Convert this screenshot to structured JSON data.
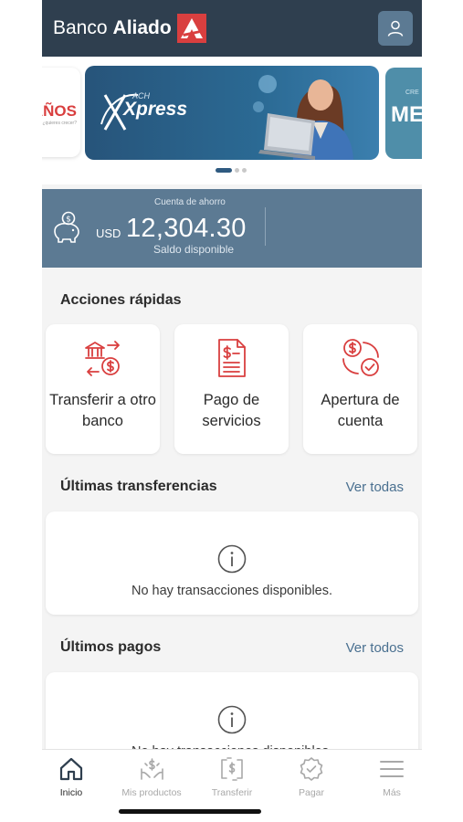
{
  "header": {
    "brand_regular": "Banco",
    "brand_bold": "Aliado"
  },
  "carousel": {
    "left_card_text": "AÑOS",
    "left_card_sub": "¿quieres crecer?",
    "main_card_tag": "ACH",
    "main_card_title": "Xpress",
    "right_card_text": "ME",
    "right_card_sub": "CRE",
    "active_slide": 1,
    "slide_count": 3
  },
  "balance": {
    "account_type": "Cuenta de ahorro",
    "currency": "USD",
    "amount": "12,304.30",
    "caption": "Saldo disponible"
  },
  "quick_actions": {
    "title": "Acciones rápidas",
    "items": [
      {
        "label": "Transferir a otro banco",
        "icon": "bank-transfer-icon"
      },
      {
        "label": "Pago de servicios",
        "icon": "invoice-icon"
      },
      {
        "label": "Apertura de cuenta",
        "icon": "open-account-icon"
      }
    ]
  },
  "transfers": {
    "title": "Últimas transferencias",
    "see_all": "Ver todas",
    "empty_text": "No hay transacciones disponibles."
  },
  "payments": {
    "title": "Últimos pagos",
    "see_all": "Ver todos",
    "empty_text": "No hay transacciones disponibles."
  },
  "bottom_nav": [
    {
      "label": "Inicio",
      "icon": "home-icon",
      "active": true
    },
    {
      "label": "Mis productos",
      "icon": "products-icon",
      "active": false
    },
    {
      "label": "Transferir",
      "icon": "transfer-icon",
      "active": false
    },
    {
      "label": "Pagar",
      "icon": "pay-icon",
      "active": false
    },
    {
      "label": "Más",
      "icon": "menu-icon",
      "active": false
    }
  ],
  "colors": {
    "header_bg": "#2f3f4f",
    "balance_bg": "#5c7a93",
    "accent_red": "#d93f3f",
    "link_blue": "#4a7090"
  }
}
